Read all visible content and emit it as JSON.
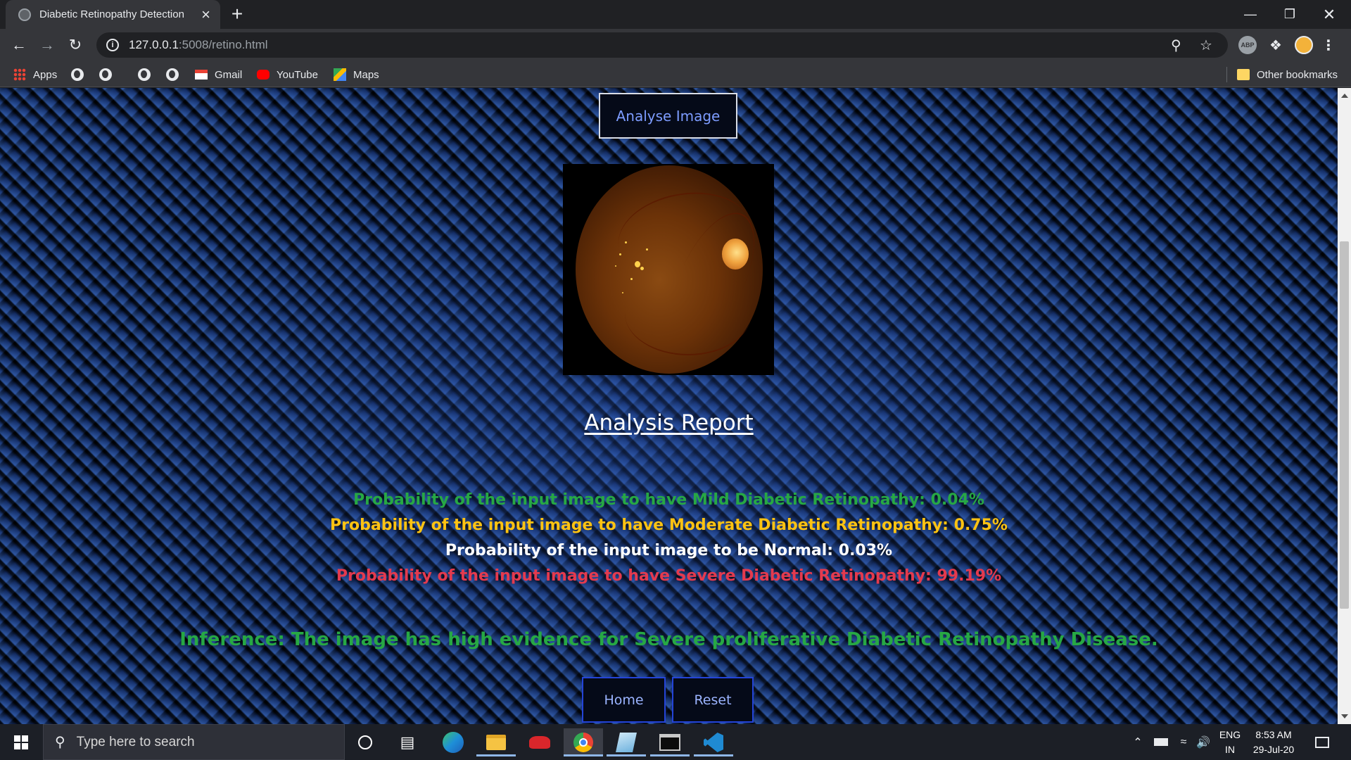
{
  "browser": {
    "tab_title": "Diabetic Retinopathy Detection",
    "url_host": "127.0.0.1",
    "url_path": ":5008/retino.html",
    "bookmarks": [
      {
        "label": "Apps"
      },
      {
        "label": ""
      },
      {
        "label": ""
      },
      {
        "label": ""
      },
      {
        "label": ""
      },
      {
        "label": "Gmail"
      },
      {
        "label": "YouTube"
      },
      {
        "label": "Maps"
      }
    ],
    "other_bookmarks": "Other bookmarks",
    "extensions": {
      "abp": "ABP"
    }
  },
  "page": {
    "analyse_button": "Analyse Image",
    "report_title": "Analysis Report",
    "probabilities": [
      {
        "text": "Probability of the input image to have Mild Diabetic Retinopathy: 0.04%",
        "color": "#27a844"
      },
      {
        "text": "Probability of the input image to have Moderate Diabetic Retinopathy: 0.75%",
        "color": "#ffc312"
      },
      {
        "text": "Probability of the input image to be Normal: 0.03%",
        "color": "#ffffff"
      },
      {
        "text": "Probability of the input image to have Severe Diabetic Retinopathy: 99.19%",
        "color": "#e43a4e"
      }
    ],
    "inference": "Inference: The image has high evidence for Severe proliferative Diabetic Retinopathy Disease.",
    "inference_color": "#27a844",
    "home_button": "Home",
    "reset_button": "Reset"
  },
  "taskbar": {
    "search_placeholder": "Type here to search",
    "language_top": "ENG",
    "language_bottom": "IN",
    "time": "8:53 AM",
    "date": "29-Jul-20"
  }
}
